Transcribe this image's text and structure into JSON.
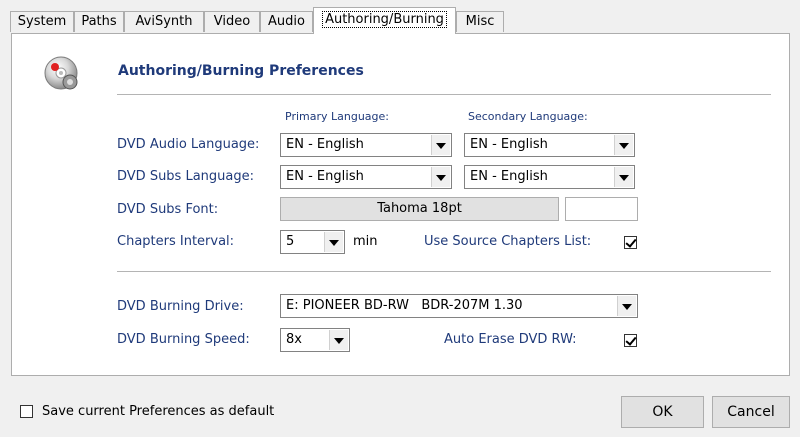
{
  "tabs": [
    "System",
    "Paths",
    "AviSynth",
    "Video",
    "Audio",
    "Authoring/Burning",
    "Misc"
  ],
  "active_tab": "Authoring/Burning",
  "section_title": "Authoring/Burning Preferences",
  "column_headers": {
    "primary": "Primary Language:",
    "secondary": "Secondary Language:"
  },
  "audio_language": {
    "label": "DVD Audio Language:",
    "primary": "EN - English",
    "secondary": "EN - English"
  },
  "subs_language": {
    "label": "DVD Subs Language:",
    "primary": "EN - English",
    "secondary": "EN - English"
  },
  "subs_font": {
    "label": "DVD Subs Font:",
    "value": "Tahoma 18pt"
  },
  "chapters": {
    "label": "Chapters Interval:",
    "value": "5",
    "unit": "min",
    "source_label": "Use Source Chapters List:",
    "source_checked": true
  },
  "burning_drive": {
    "label": "DVD Burning Drive:",
    "value": "E: PIONEER BD-RW   BDR-207M 1.30"
  },
  "burning_speed": {
    "label": "DVD Burning Speed:",
    "value": "8x",
    "erase_label": "Auto Erase DVD RW:",
    "erase_checked": true
  },
  "footer": {
    "save_default_label": "Save current Preferences as default",
    "save_default_checked": false,
    "ok_label": "OK",
    "cancel_label": "Cancel"
  },
  "icon": "dvd-disc-icon"
}
